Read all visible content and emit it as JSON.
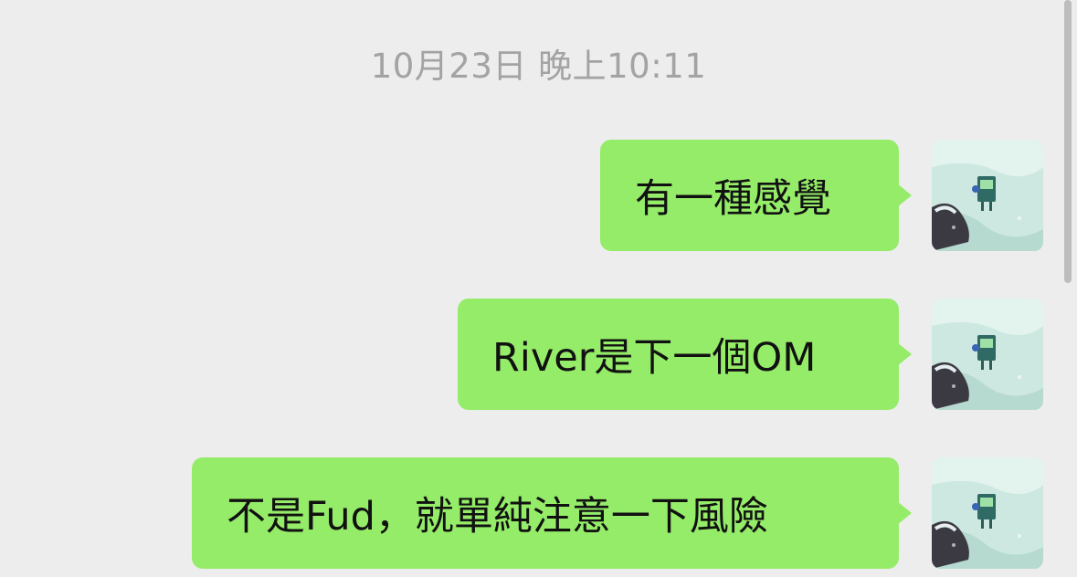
{
  "chat": {
    "timestamp": "10月23日 晚上10:11",
    "messages": [
      {
        "text": "有一種感覺",
        "sender": "self"
      },
      {
        "text": "River是下一個OM",
        "sender": "self"
      },
      {
        "text": "不是Fud，就單純注意一下風險",
        "sender": "self"
      }
    ]
  },
  "colors": {
    "background": "#ededed",
    "bubble_green": "#95ec69",
    "timestamp_gray": "#a3a3a3"
  },
  "icons": {
    "avatar": "robot-character-avatar"
  }
}
